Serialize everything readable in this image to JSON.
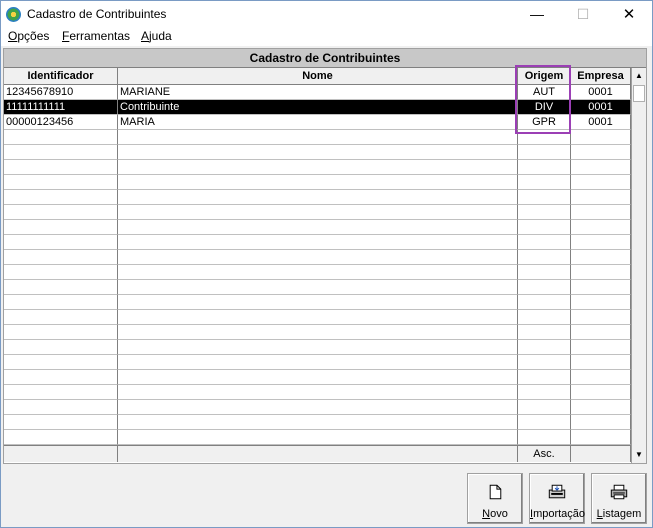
{
  "window": {
    "title": "Cadastro de Contribuintes",
    "controls": {
      "minimize": "—",
      "maximize": "☐",
      "close": "✕"
    }
  },
  "menu": [
    {
      "label": "Opções",
      "mnemonic": "O",
      "rest": "pções"
    },
    {
      "label": "Ferramentas",
      "mnemonic": "F",
      "rest": "erramentas"
    },
    {
      "label": "Ajuda",
      "mnemonic": "A",
      "rest": "juda"
    }
  ],
  "grid": {
    "title": "Cadastro de Contribuintes",
    "columns": [
      "Identificador",
      "Nome",
      "Origem",
      "Empresa"
    ],
    "rows": [
      {
        "id": "12345678910",
        "nome": "MARIANE",
        "origem": "AUT",
        "empresa": "0001"
      },
      {
        "id": "11111111111",
        "nome": "Contribuinte",
        "origem": "DIV",
        "empresa": "0001"
      },
      {
        "id": "00000123456",
        "nome": "MARIA",
        "origem": "GPR",
        "empresa": "0001"
      }
    ],
    "selected_row_index": 1,
    "sort_indicator": "Asc."
  },
  "buttons": {
    "novo": {
      "mnemonic": "N",
      "rest": "ovo"
    },
    "importacao": {
      "mnemonic": "I",
      "rest": "mportação"
    },
    "listagem": {
      "mnemonic": "L",
      "rest": "istagem"
    }
  },
  "colors": {
    "highlight": "#9b3fb5",
    "selected_bg": "#000000"
  }
}
